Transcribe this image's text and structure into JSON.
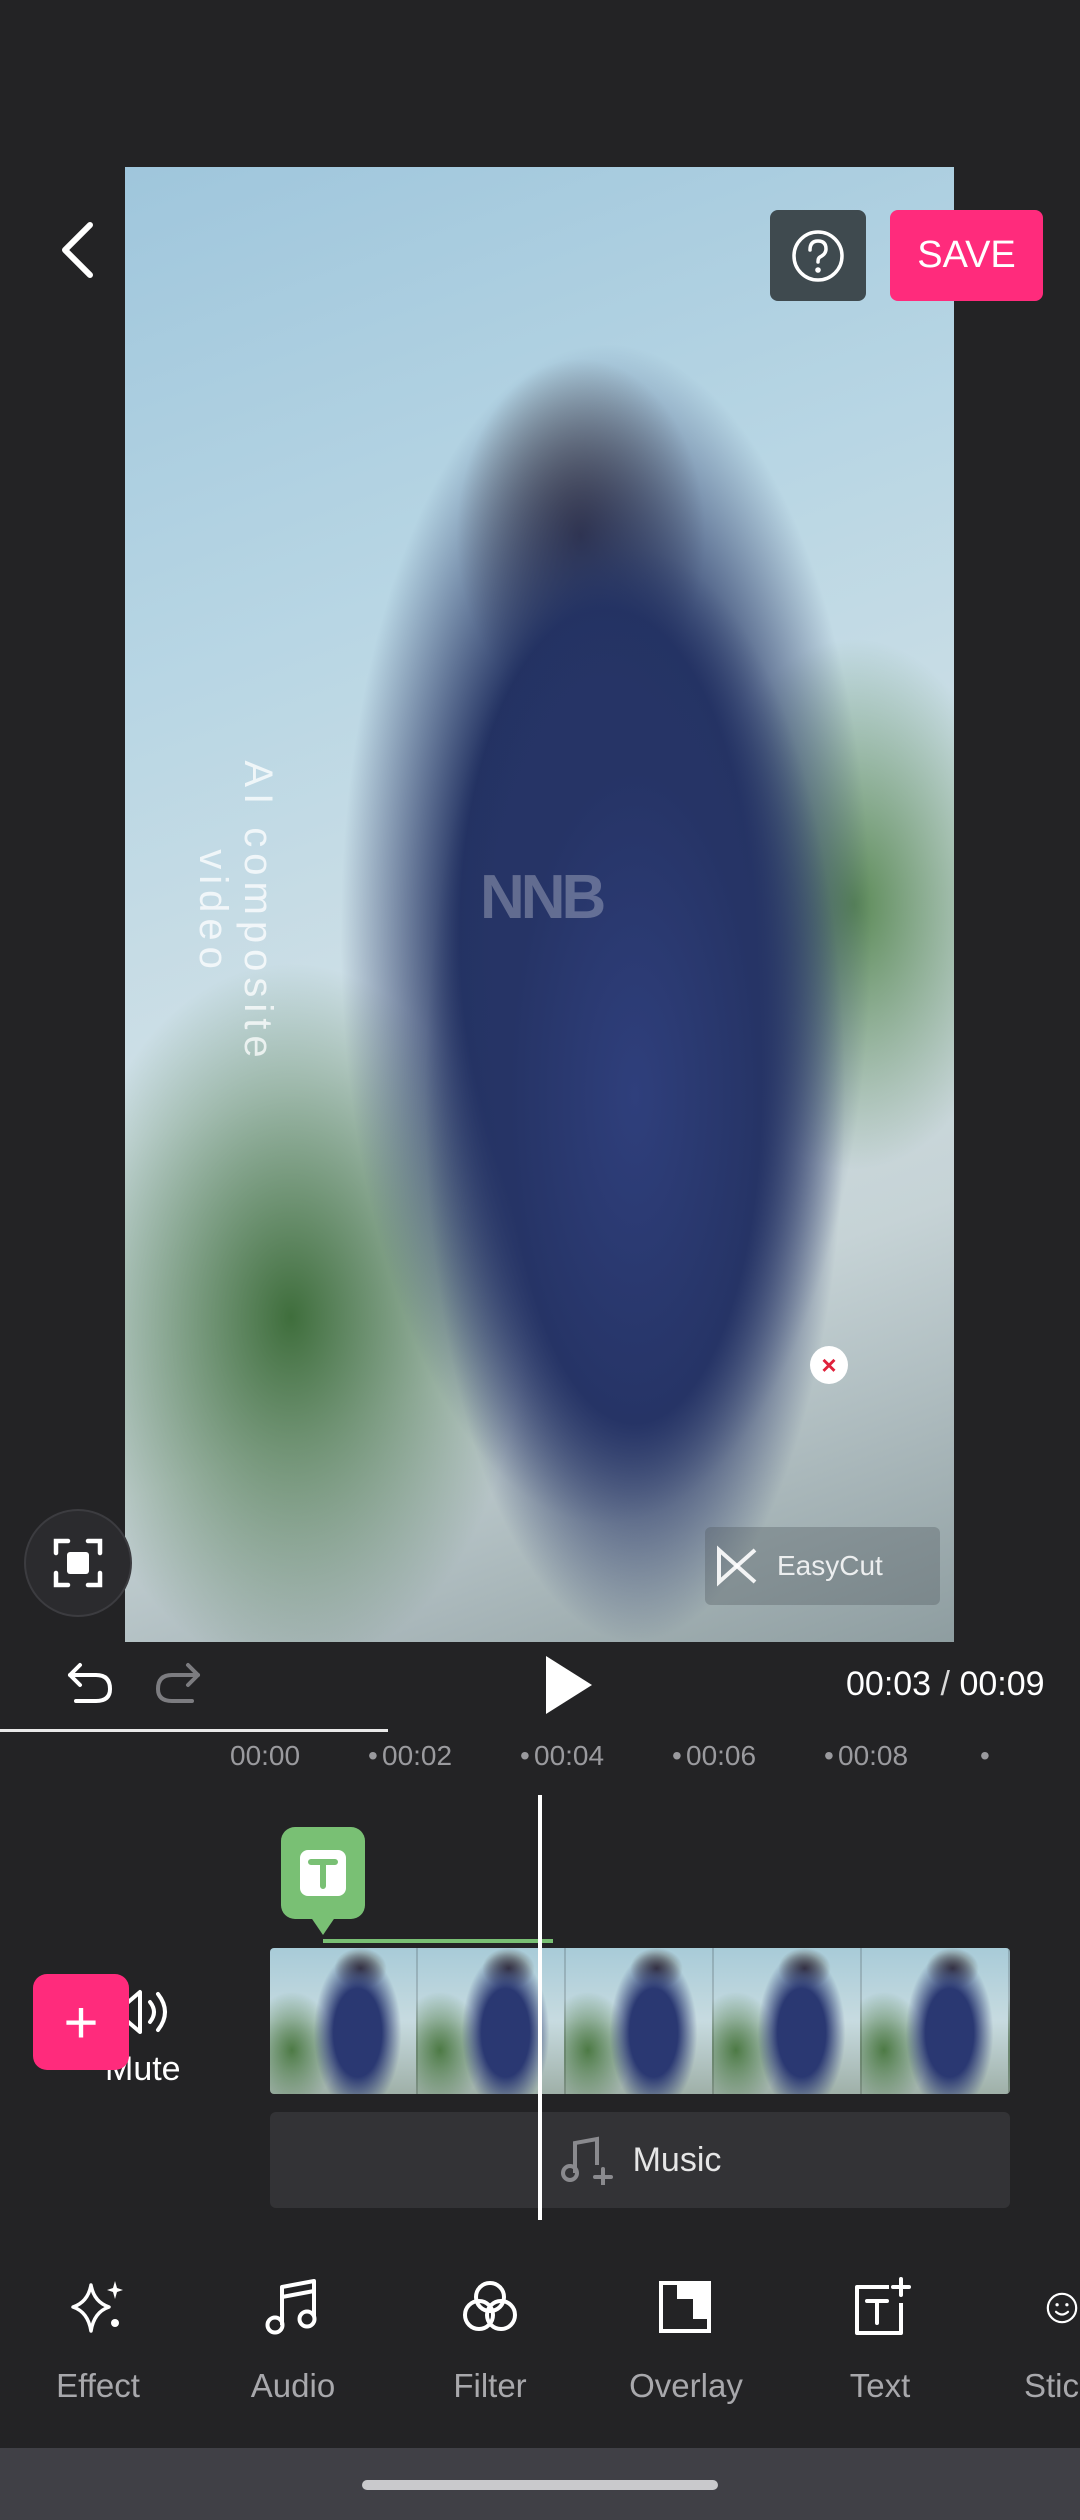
{
  "header": {
    "save_label": "SAVE",
    "help_icon": "question-circle-icon",
    "back_icon": "chevron-left-icon"
  },
  "preview": {
    "vertical_watermark": "AI composite video",
    "center_mark": "NNB",
    "easycut_label": "EasyCut",
    "close_symbol": "×"
  },
  "playback": {
    "current_time": "00:03",
    "separator": " / ",
    "total_time": "00:09",
    "progress_fraction": 0.33
  },
  "ruler": {
    "ticks": [
      "00:00",
      "00:02",
      "00:04",
      "00:06",
      "00:08"
    ]
  },
  "timeline": {
    "text_clip_glyph": "T",
    "mute_label": "Mute",
    "add_symbol": "+",
    "music_label": "Music"
  },
  "toolbar": {
    "items": [
      {
        "label": "Effect",
        "icon": "sparkle-icon"
      },
      {
        "label": "Audio",
        "icon": "music-note-icon"
      },
      {
        "label": "Filter",
        "icon": "filter-circles-icon"
      },
      {
        "label": "Overlay",
        "icon": "overlay-icon"
      },
      {
        "label": "Text",
        "icon": "add-text-icon"
      },
      {
        "label": "Stic",
        "icon": "sticker-icon"
      }
    ]
  },
  "colors": {
    "accent": "#ff2b7c",
    "text_clip": "#79c074",
    "background": "#232325"
  }
}
